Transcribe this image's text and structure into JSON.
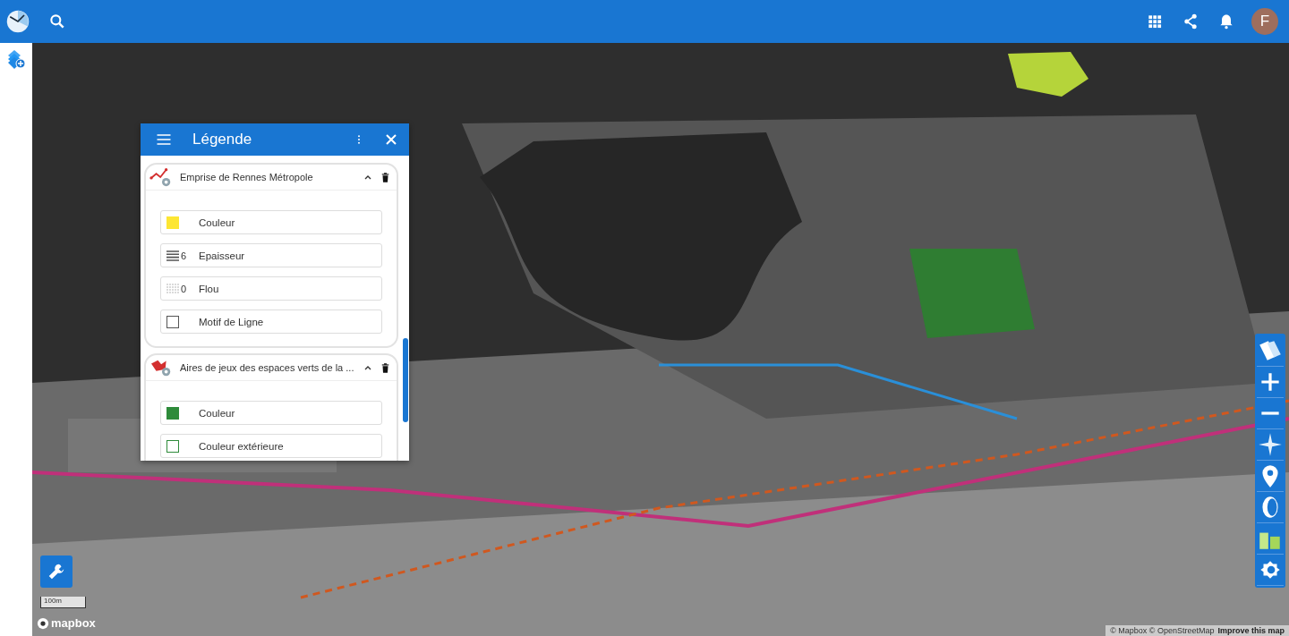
{
  "topbar": {
    "avatar": "F"
  },
  "legend": {
    "title": "Légende",
    "layers": [
      {
        "title": "Emprise de Rennes Métropole",
        "kind": "line",
        "expanded": true,
        "items": [
          {
            "kind": "swatch",
            "label": "Couleur",
            "color": "#fde633",
            "outline": false
          },
          {
            "kind": "width",
            "label": "Epaisseur",
            "value": "6"
          },
          {
            "kind": "blur",
            "label": "Flou",
            "value": "0"
          },
          {
            "kind": "pattern",
            "label": "Motif de Ligne"
          }
        ]
      },
      {
        "title": "Aires de jeux des espaces verts de la ...",
        "kind": "polygon",
        "expanded": true,
        "items": [
          {
            "kind": "swatch",
            "label": "Couleur",
            "color": "#2e8b3a",
            "outline": false
          },
          {
            "kind": "swatch",
            "label": "Couleur extérieure",
            "color": "#2e8b3a",
            "outline": true
          }
        ]
      }
    ]
  },
  "map": {
    "scale": "100m",
    "logo": "mapbox",
    "attribution": "© Mapbox © OpenStreetMap",
    "improve_link": "Improve this map"
  }
}
